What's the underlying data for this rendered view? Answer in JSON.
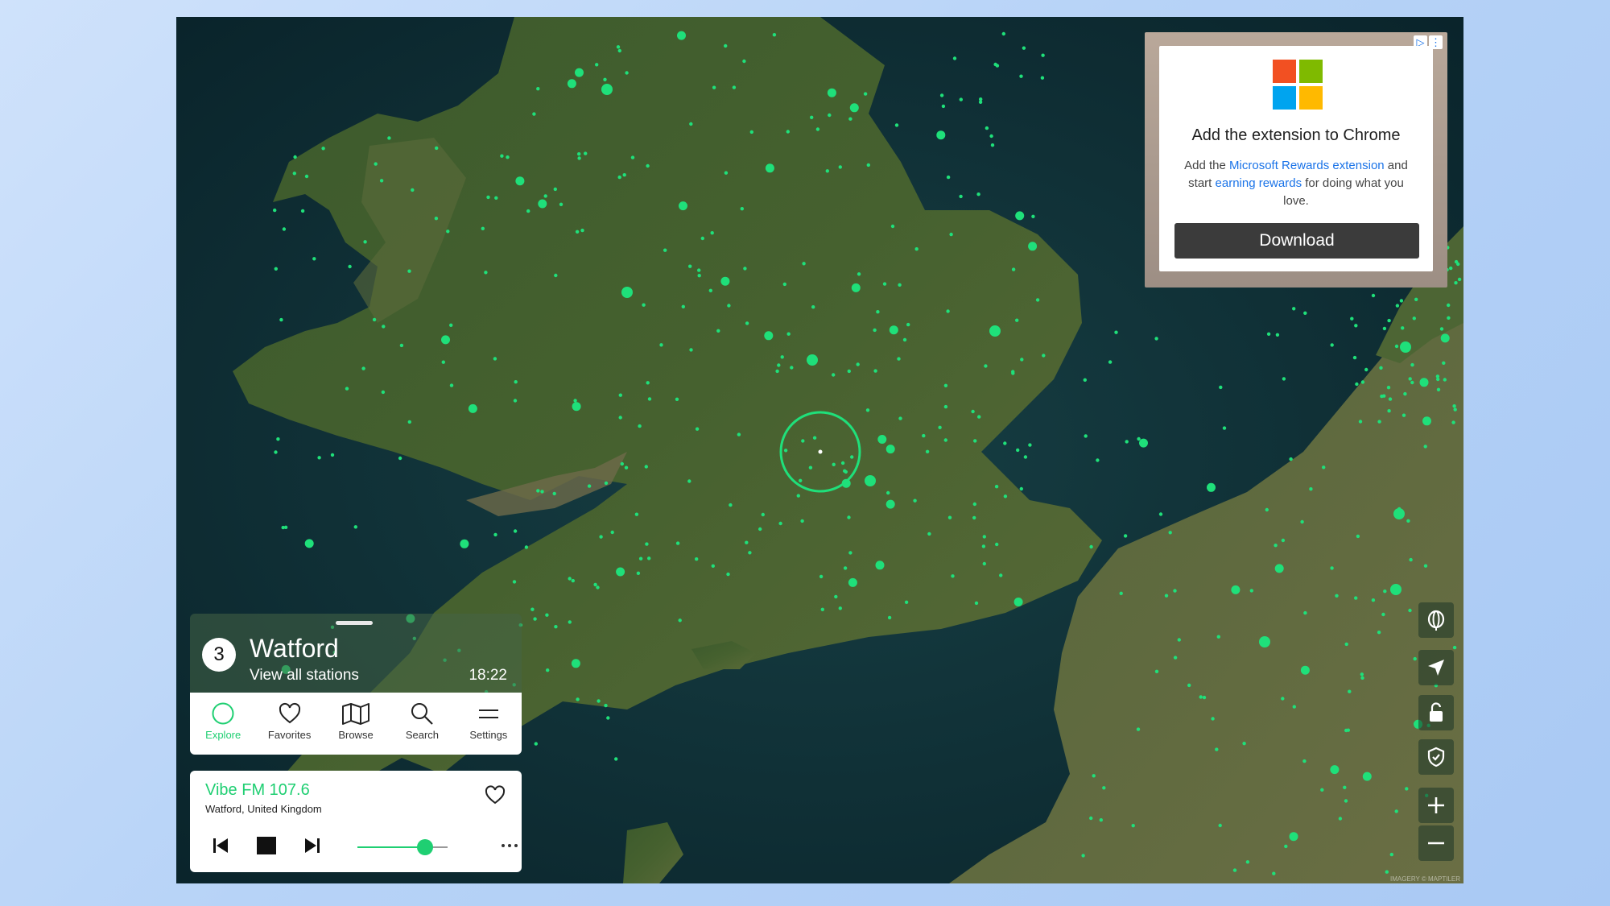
{
  "ad": {
    "choices_icon": "ad-choices-icon",
    "menu_icon": "ad-menu-icon",
    "logo_colors": [
      "#f25022",
      "#7fba00",
      "#00a4ef",
      "#ffb900"
    ],
    "title": "Add the extension to Chrome",
    "body_prefix": "Add the ",
    "body_link1": "Microsoft Rewards extension",
    "body_mid": " and start ",
    "body_link2": "earning rewards",
    "body_suffix": " for doing what you love.",
    "button_label": "Download"
  },
  "map": {
    "accent_color": "#1fe07a",
    "attribution": "IMAGERY © MAPTILER",
    "controls": [
      "globe-icon",
      "locate-arrow-icon",
      "lock-icon",
      "shield-icon",
      "zoom-in-icon",
      "zoom-out-icon"
    ]
  },
  "panel": {
    "station_count": "3",
    "city": "Watford",
    "view_all": "View all stations",
    "time": "18:22",
    "tabs": [
      {
        "label": "Explore",
        "icon": "explore-circle-icon",
        "active": true
      },
      {
        "label": "Favorites",
        "icon": "heart-icon",
        "active": false
      },
      {
        "label": "Browse",
        "icon": "map-icon",
        "active": false
      },
      {
        "label": "Search",
        "icon": "search-icon",
        "active": false
      },
      {
        "label": "Settings",
        "icon": "menu-icon",
        "active": false
      }
    ]
  },
  "player": {
    "station": "Vibe FM 107.6",
    "location": "Watford, United Kingdom",
    "volume": 0.75,
    "accent_color": "#1fcf72"
  }
}
